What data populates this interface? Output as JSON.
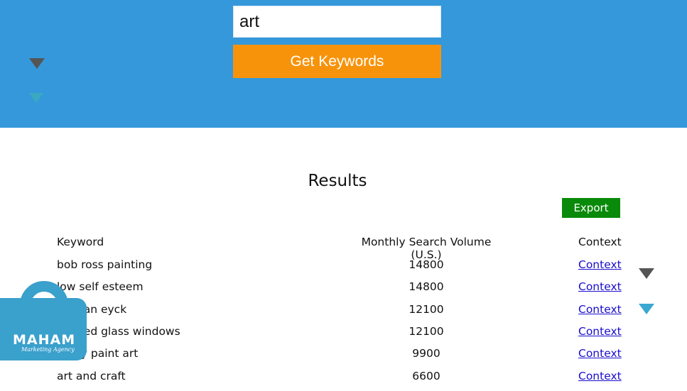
{
  "header": {
    "search_value": "art",
    "get_keywords_label": "Get Keywords",
    "bg_color": "#3498db",
    "button_color": "#f7930b"
  },
  "results": {
    "title": "Results",
    "export_label": "Export",
    "columns": [
      "Keyword",
      "Monthly Search Volume (U.S.)",
      "Context"
    ],
    "rows": [
      {
        "keyword": "bob ross painting",
        "volume": "14800",
        "context": "Context"
      },
      {
        "keyword": "low self esteem",
        "volume": "14800",
        "context": "Context"
      },
      {
        "keyword": "jan van eyck",
        "volume": "12100",
        "context": "Context"
      },
      {
        "keyword": "stained glass windows",
        "volume": "12100",
        "context": "Context"
      },
      {
        "keyword": "spray paint art",
        "volume": "9900",
        "context": "Context"
      },
      {
        "keyword": "art and craft",
        "volume": "6600",
        "context": "Context"
      }
    ]
  },
  "watermark": {
    "brand": "MAHAM",
    "tagline": "Marketing Agency"
  }
}
